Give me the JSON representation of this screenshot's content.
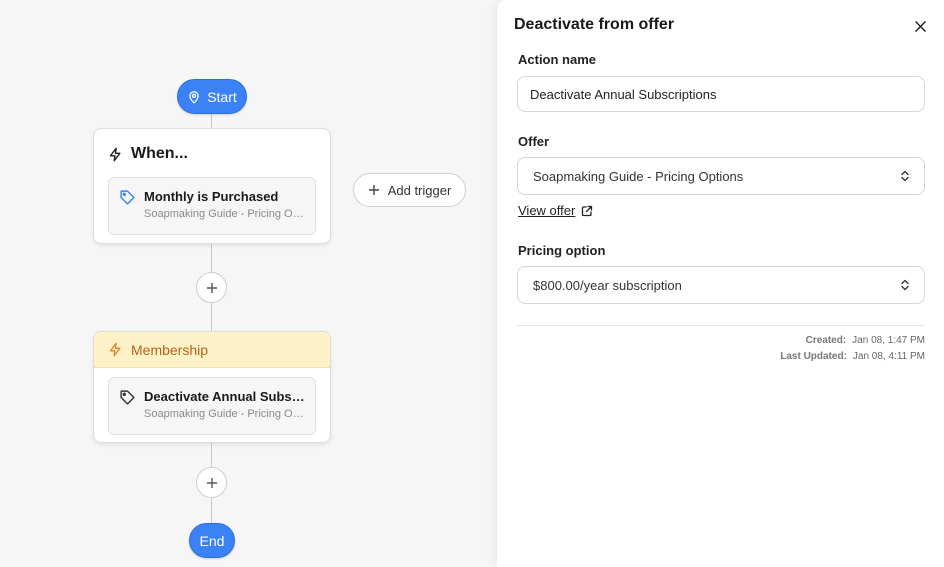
{
  "flow": {
    "start_label": "Start",
    "end_label": "End",
    "trigger_card": {
      "heading": "When...",
      "item_title": "Monthly is Purchased",
      "item_subtitle": "Soapmaking Guide - Pricing Options"
    },
    "add_trigger_label": "Add trigger",
    "action_card": {
      "heading": "Membership",
      "item_title": "Deactivate Annual Subscriptions",
      "item_subtitle": "Soapmaking Guide - Pricing Options"
    },
    "accent_color": "#3b82f6",
    "membership_color": "#fdf1c8"
  },
  "panel": {
    "title": "Deactivate from offer",
    "action_name_label": "Action name",
    "action_name_value": "Deactivate Annual Subscriptions",
    "offer_label": "Offer",
    "offer_value": "Soapmaking Guide - Pricing Options",
    "view_offer_label": "View offer",
    "pricing_label": "Pricing option",
    "pricing_value": "$800.00/year subscription",
    "created_label": "Created:",
    "created_value": "Jan 08, 1:47 PM",
    "updated_label": "Last Updated:",
    "updated_value": "Jan 08, 4:11 PM"
  },
  "icons": {
    "start": "map-pin-icon",
    "trigger": "lightning-icon",
    "tag": "tag-icon",
    "add": "plus-icon",
    "close": "close-icon",
    "select": "chevron-up-down-icon",
    "external": "external-link-icon"
  }
}
